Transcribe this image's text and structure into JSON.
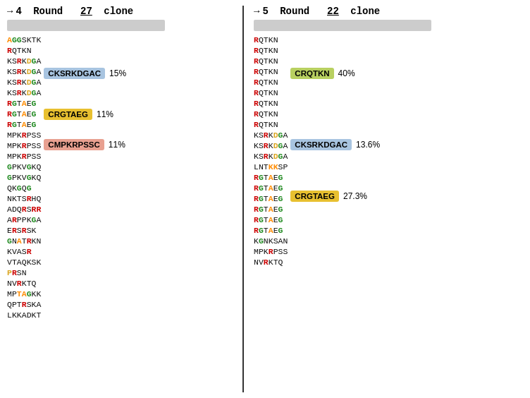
{
  "left_panel": {
    "header": "→4 Round   27 clone",
    "arrow": "→",
    "round_label": "Round",
    "round_num": "4",
    "clone_count": "27",
    "clone_label": "clone",
    "sequences": [
      {
        "text": "AGGSKTK",
        "colors": [
          {
            "c": "o"
          },
          {
            "c": "g"
          },
          {
            "c": "g"
          },
          {
            "c": "k"
          },
          {
            "c": "k"
          },
          {
            "c": "k"
          },
          {
            "c": "k"
          }
        ]
      },
      {
        "text": "RQTKN",
        "colors": [
          {
            "c": "r"
          },
          {
            "c": "k"
          },
          {
            "c": "k"
          },
          {
            "c": "k"
          },
          {
            "c": "k"
          }
        ]
      },
      {
        "text": "KSRKDGA",
        "colors": [
          {
            "c": "k"
          },
          {
            "c": "k"
          },
          {
            "c": "r"
          },
          {
            "c": "k"
          },
          {
            "c": "y"
          },
          {
            "c": "g"
          },
          {
            "c": "k"
          }
        ]
      },
      {
        "text": "KSRKDGA",
        "colors": [
          {
            "c": "k"
          },
          {
            "c": "k"
          },
          {
            "c": "r"
          },
          {
            "c": "k"
          },
          {
            "c": "y"
          },
          {
            "c": "g"
          },
          {
            "c": "k"
          }
        ]
      },
      {
        "text": "KSRKDGA",
        "colors": [
          {
            "c": "k"
          },
          {
            "c": "k"
          },
          {
            "c": "r"
          },
          {
            "c": "k"
          },
          {
            "c": "y"
          },
          {
            "c": "g"
          },
          {
            "c": "k"
          }
        ]
      },
      {
        "text": "KSRKDGA",
        "colors": [
          {
            "c": "k"
          },
          {
            "c": "k"
          },
          {
            "c": "r"
          },
          {
            "c": "k"
          },
          {
            "c": "y"
          },
          {
            "c": "g"
          },
          {
            "c": "k"
          }
        ]
      },
      {
        "text": "RGTAEG",
        "colors": [
          {
            "c": "r"
          },
          {
            "c": "g"
          },
          {
            "c": "k"
          },
          {
            "c": "o"
          },
          {
            "c": "k"
          },
          {
            "c": "g"
          }
        ]
      },
      {
        "text": "RGTAEG",
        "colors": [
          {
            "c": "r"
          },
          {
            "c": "g"
          },
          {
            "c": "k"
          },
          {
            "c": "o"
          },
          {
            "c": "k"
          },
          {
            "c": "g"
          }
        ]
      },
      {
        "text": "RGTAEG",
        "colors": [
          {
            "c": "r"
          },
          {
            "c": "g"
          },
          {
            "c": "k"
          },
          {
            "c": "o"
          },
          {
            "c": "k"
          },
          {
            "c": "g"
          }
        ]
      },
      {
        "text": "MPKRPSS",
        "colors": [
          {
            "c": "k"
          },
          {
            "c": "k"
          },
          {
            "c": "k"
          },
          {
            "c": "r"
          },
          {
            "c": "k"
          },
          {
            "c": "k"
          },
          {
            "c": "k"
          }
        ]
      },
      {
        "text": "MPKRPSS",
        "colors": [
          {
            "c": "k"
          },
          {
            "c": "k"
          },
          {
            "c": "k"
          },
          {
            "c": "r"
          },
          {
            "c": "k"
          },
          {
            "c": "k"
          },
          {
            "c": "k"
          }
        ]
      },
      {
        "text": "MPKRPSS",
        "colors": [
          {
            "c": "k"
          },
          {
            "c": "k"
          },
          {
            "c": "k"
          },
          {
            "c": "r"
          },
          {
            "c": "k"
          },
          {
            "c": "k"
          },
          {
            "c": "k"
          }
        ]
      },
      {
        "text": "GPKVGKQ",
        "colors": [
          {
            "c": "g"
          },
          {
            "c": "k"
          },
          {
            "c": "k"
          },
          {
            "c": "k"
          },
          {
            "c": "g"
          },
          {
            "c": "k"
          },
          {
            "c": "k"
          }
        ]
      },
      {
        "text": "GPKVGKQ",
        "colors": [
          {
            "c": "g"
          },
          {
            "c": "k"
          },
          {
            "c": "k"
          },
          {
            "c": "k"
          },
          {
            "c": "g"
          },
          {
            "c": "k"
          },
          {
            "c": "k"
          }
        ]
      },
      {
        "text": "QKGQG",
        "colors": [
          {
            "c": "k"
          },
          {
            "c": "k"
          },
          {
            "c": "g"
          },
          {
            "c": "k"
          },
          {
            "c": "g"
          }
        ]
      },
      {
        "text": "NKTSRHQ",
        "colors": [
          {
            "c": "k"
          },
          {
            "c": "k"
          },
          {
            "c": "k"
          },
          {
            "c": "k"
          },
          {
            "c": "r"
          },
          {
            "c": "k"
          },
          {
            "c": "k"
          }
        ]
      },
      {
        "text": "ADQRSRR",
        "colors": [
          {
            "c": "k"
          },
          {
            "c": "k"
          },
          {
            "c": "k"
          },
          {
            "c": "r"
          },
          {
            "c": "k"
          },
          {
            "c": "r"
          },
          {
            "c": "r"
          }
        ]
      },
      {
        "text": "ARPPKGA",
        "colors": [
          {
            "c": "k"
          },
          {
            "c": "r"
          },
          {
            "c": "k"
          },
          {
            "c": "k"
          },
          {
            "c": "k"
          },
          {
            "c": "g"
          },
          {
            "c": "k"
          }
        ]
      },
      {
        "text": "ERSRSK",
        "colors": [
          {
            "c": "k"
          },
          {
            "c": "r"
          },
          {
            "c": "k"
          },
          {
            "c": "r"
          },
          {
            "c": "k"
          },
          {
            "c": "k"
          }
        ]
      },
      {
        "text": "GNATRKN",
        "colors": [
          {
            "c": "g"
          },
          {
            "c": "k"
          },
          {
            "c": "o"
          },
          {
            "c": "k"
          },
          {
            "c": "r"
          },
          {
            "c": "k"
          },
          {
            "c": "k"
          }
        ]
      },
      {
        "text": "KVASR",
        "colors": [
          {
            "c": "k"
          },
          {
            "c": "k"
          },
          {
            "c": "k"
          },
          {
            "c": "k"
          },
          {
            "c": "r"
          }
        ]
      },
      {
        "text": "VTAQKSK",
        "colors": [
          {
            "c": "k"
          },
          {
            "c": "k"
          },
          {
            "c": "k"
          },
          {
            "c": "k"
          },
          {
            "c": "k"
          },
          {
            "c": "k"
          },
          {
            "c": "k"
          }
        ]
      },
      {
        "text": "PRSN",
        "colors": [
          {
            "c": "y"
          },
          {
            "c": "r"
          },
          {
            "c": "k"
          },
          {
            "c": "k"
          }
        ]
      },
      {
        "text": "NVRKTQ",
        "colors": [
          {
            "c": "k"
          },
          {
            "c": "k"
          },
          {
            "c": "r"
          },
          {
            "c": "k"
          },
          {
            "c": "k"
          },
          {
            "c": "k"
          }
        ]
      },
      {
        "text": "MPTAGKK",
        "colors": [
          {
            "c": "k"
          },
          {
            "c": "k"
          },
          {
            "c": "o"
          },
          {
            "c": "o"
          },
          {
            "c": "g"
          },
          {
            "c": "k"
          },
          {
            "c": "k"
          }
        ]
      },
      {
        "text": "QPTRSKA",
        "colors": [
          {
            "c": "k"
          },
          {
            "c": "k"
          },
          {
            "c": "k"
          },
          {
            "c": "r"
          },
          {
            "c": "k"
          },
          {
            "c": "k"
          },
          {
            "c": "k"
          }
        ]
      },
      {
        "text": "LKKADKT",
        "colors": [
          {
            "c": "k"
          },
          {
            "c": "k"
          },
          {
            "c": "k"
          },
          {
            "c": "k"
          },
          {
            "c": "k"
          },
          {
            "c": "k"
          },
          {
            "c": "k"
          }
        ]
      }
    ],
    "badges": [
      {
        "label": "CKSRKDGAC",
        "pct": "15%",
        "color": "badge-blue",
        "top_row": 3
      },
      {
        "label": "CRGTAEG",
        "pct": "11%",
        "color": "badge-yellow",
        "top_row": 7
      },
      {
        "label": "CMPKRPSSC",
        "pct": "11%",
        "color": "badge-salmon",
        "top_row": 10
      }
    ]
  },
  "right_panel": {
    "header": "→5 Round   22 clone",
    "arrow": "→",
    "round_label": "Round",
    "round_num": "5",
    "clone_count": "22",
    "clone_label": "clone",
    "sequences": [
      {
        "text": "RQTKN",
        "colors": [
          {
            "c": "r"
          },
          {
            "c": "k"
          },
          {
            "c": "k"
          },
          {
            "c": "k"
          },
          {
            "c": "k"
          }
        ]
      },
      {
        "text": "RQTKN",
        "colors": [
          {
            "c": "r"
          },
          {
            "c": "k"
          },
          {
            "c": "k"
          },
          {
            "c": "k"
          },
          {
            "c": "k"
          }
        ]
      },
      {
        "text": "RQTKN",
        "colors": [
          {
            "c": "r"
          },
          {
            "c": "k"
          },
          {
            "c": "k"
          },
          {
            "c": "k"
          },
          {
            "c": "k"
          }
        ]
      },
      {
        "text": "RQTKN",
        "colors": [
          {
            "c": "r"
          },
          {
            "c": "k"
          },
          {
            "c": "k"
          },
          {
            "c": "k"
          },
          {
            "c": "k"
          }
        ]
      },
      {
        "text": "RQTKN",
        "colors": [
          {
            "c": "r"
          },
          {
            "c": "k"
          },
          {
            "c": "k"
          },
          {
            "c": "k"
          },
          {
            "c": "k"
          }
        ]
      },
      {
        "text": "RQTKN",
        "colors": [
          {
            "c": "r"
          },
          {
            "c": "k"
          },
          {
            "c": "k"
          },
          {
            "c": "k"
          },
          {
            "c": "k"
          }
        ]
      },
      {
        "text": "RQTKN",
        "colors": [
          {
            "c": "r"
          },
          {
            "c": "k"
          },
          {
            "c": "k"
          },
          {
            "c": "k"
          },
          {
            "c": "k"
          }
        ]
      },
      {
        "text": "RQTKN",
        "colors": [
          {
            "c": "r"
          },
          {
            "c": "k"
          },
          {
            "c": "k"
          },
          {
            "c": "k"
          },
          {
            "c": "k"
          }
        ]
      },
      {
        "text": "RQTKN",
        "colors": [
          {
            "c": "r"
          },
          {
            "c": "k"
          },
          {
            "c": "k"
          },
          {
            "c": "k"
          },
          {
            "c": "k"
          }
        ]
      },
      {
        "text": "KSRKDGA",
        "colors": [
          {
            "c": "k"
          },
          {
            "c": "k"
          },
          {
            "c": "r"
          },
          {
            "c": "k"
          },
          {
            "c": "y"
          },
          {
            "c": "g"
          },
          {
            "c": "k"
          }
        ]
      },
      {
        "text": "KSRKDGA",
        "colors": [
          {
            "c": "k"
          },
          {
            "c": "k"
          },
          {
            "c": "r"
          },
          {
            "c": "k"
          },
          {
            "c": "y"
          },
          {
            "c": "g"
          },
          {
            "c": "k"
          }
        ]
      },
      {
        "text": "KSRKDGA",
        "colors": [
          {
            "c": "k"
          },
          {
            "c": "k"
          },
          {
            "c": "r"
          },
          {
            "c": "k"
          },
          {
            "c": "y"
          },
          {
            "c": "g"
          },
          {
            "c": "k"
          }
        ]
      },
      {
        "text": "LNTKKSP",
        "colors": [
          {
            "c": "k"
          },
          {
            "c": "k"
          },
          {
            "c": "k"
          },
          {
            "c": "o"
          },
          {
            "c": "o"
          },
          {
            "c": "k"
          },
          {
            "c": "k"
          }
        ]
      },
      {
        "text": "RGTAEG",
        "colors": [
          {
            "c": "r"
          },
          {
            "c": "g"
          },
          {
            "c": "k"
          },
          {
            "c": "o"
          },
          {
            "c": "k"
          },
          {
            "c": "g"
          }
        ]
      },
      {
        "text": "RGTAEG",
        "colors": [
          {
            "c": "r"
          },
          {
            "c": "g"
          },
          {
            "c": "k"
          },
          {
            "c": "o"
          },
          {
            "c": "k"
          },
          {
            "c": "g"
          }
        ]
      },
      {
        "text": "RGTAEG",
        "colors": [
          {
            "c": "r"
          },
          {
            "c": "g"
          },
          {
            "c": "k"
          },
          {
            "c": "o"
          },
          {
            "c": "k"
          },
          {
            "c": "g"
          }
        ]
      },
      {
        "text": "RGTAEG",
        "colors": [
          {
            "c": "r"
          },
          {
            "c": "g"
          },
          {
            "c": "k"
          },
          {
            "c": "o"
          },
          {
            "c": "k"
          },
          {
            "c": "g"
          }
        ]
      },
      {
        "text": "RGTAEG",
        "colors": [
          {
            "c": "r"
          },
          {
            "c": "g"
          },
          {
            "c": "k"
          },
          {
            "c": "o"
          },
          {
            "c": "k"
          },
          {
            "c": "g"
          }
        ]
      },
      {
        "text": "RGTAEG",
        "colors": [
          {
            "c": "r"
          },
          {
            "c": "g"
          },
          {
            "c": "k"
          },
          {
            "c": "o"
          },
          {
            "c": "k"
          },
          {
            "c": "g"
          }
        ]
      },
      {
        "text": "KGNKSAN",
        "colors": [
          {
            "c": "k"
          },
          {
            "c": "g"
          },
          {
            "c": "k"
          },
          {
            "c": "k"
          },
          {
            "c": "k"
          },
          {
            "c": "k"
          },
          {
            "c": "k"
          }
        ]
      },
      {
        "text": "MPKRPSS",
        "colors": [
          {
            "c": "k"
          },
          {
            "c": "k"
          },
          {
            "c": "k"
          },
          {
            "c": "r"
          },
          {
            "c": "k"
          },
          {
            "c": "k"
          },
          {
            "c": "k"
          }
        ]
      },
      {
        "text": "NVRKTQ",
        "colors": [
          {
            "c": "k"
          },
          {
            "c": "k"
          },
          {
            "c": "r"
          },
          {
            "c": "k"
          },
          {
            "c": "k"
          },
          {
            "c": "k"
          }
        ]
      }
    ],
    "badges": [
      {
        "label": "CRQTKN",
        "pct": "40%",
        "color": "badge-green",
        "top_row": 3
      },
      {
        "label": "CKSRKDGAC",
        "pct": "13.6%",
        "color": "badge-blue",
        "top_row": 10
      },
      {
        "label": "CRGTAEG",
        "pct": "27.3%",
        "color": "badge-gold",
        "top_row": 15
      }
    ]
  }
}
